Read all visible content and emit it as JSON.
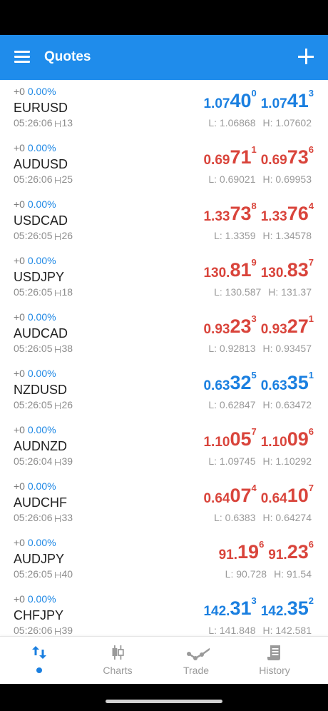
{
  "app": {
    "title": "Quotes"
  },
  "quotes": [
    {
      "change": "+0",
      "percent": "0.00%",
      "symbol": "EURUSD",
      "time": "05:26:06",
      "spread": "13",
      "color": "blue",
      "bid": {
        "base": "1.07",
        "big": "40",
        "sup": "0"
      },
      "ask": {
        "base": "1.07",
        "big": "41",
        "sup": "3"
      },
      "low": "L: 1.06868",
      "high": "H: 1.07602"
    },
    {
      "change": "+0",
      "percent": "0.00%",
      "symbol": "AUDUSD",
      "time": "05:26:06",
      "spread": "25",
      "color": "red",
      "bid": {
        "base": "0.69",
        "big": "71",
        "sup": "1"
      },
      "ask": {
        "base": "0.69",
        "big": "73",
        "sup": "6"
      },
      "low": "L: 0.69021",
      "high": "H: 0.69953"
    },
    {
      "change": "+0",
      "percent": "0.00%",
      "symbol": "USDCAD",
      "time": "05:26:05",
      "spread": "26",
      "color": "red",
      "bid": {
        "base": "1.33",
        "big": "73",
        "sup": "8"
      },
      "ask": {
        "base": "1.33",
        "big": "76",
        "sup": "4"
      },
      "low": "L: 1.3359",
      "high": "H: 1.34578"
    },
    {
      "change": "+0",
      "percent": "0.00%",
      "symbol": "USDJPY",
      "time": "05:26:05",
      "spread": "18",
      "color": "red",
      "bid": {
        "base": "130.",
        "big": "81",
        "sup": "9"
      },
      "ask": {
        "base": "130.",
        "big": "83",
        "sup": "7"
      },
      "low": "L: 130.587",
      "high": "H: 131.37"
    },
    {
      "change": "+0",
      "percent": "0.00%",
      "symbol": "AUDCAD",
      "time": "05:26:05",
      "spread": "38",
      "color": "red",
      "bid": {
        "base": "0.93",
        "big": "23",
        "sup": "3"
      },
      "ask": {
        "base": "0.93",
        "big": "27",
        "sup": "1"
      },
      "low": "L: 0.92813",
      "high": "H: 0.93457"
    },
    {
      "change": "+0",
      "percent": "0.00%",
      "symbol": "NZDUSD",
      "time": "05:26:05",
      "spread": "26",
      "color": "blue",
      "bid": {
        "base": "0.63",
        "big": "32",
        "sup": "5"
      },
      "ask": {
        "base": "0.63",
        "big": "35",
        "sup": "1"
      },
      "low": "L: 0.62847",
      "high": "H: 0.63472"
    },
    {
      "change": "+0",
      "percent": "0.00%",
      "symbol": "AUDNZD",
      "time": "05:26:04",
      "spread": "39",
      "color": "red",
      "bid": {
        "base": "1.10",
        "big": "05",
        "sup": "7"
      },
      "ask": {
        "base": "1.10",
        "big": "09",
        "sup": "6"
      },
      "low": "L: 1.09745",
      "high": "H: 1.10292"
    },
    {
      "change": "+0",
      "percent": "0.00%",
      "symbol": "AUDCHF",
      "time": "05:26:06",
      "spread": "33",
      "color": "red",
      "bid": {
        "base": "0.64",
        "big": "07",
        "sup": "4"
      },
      "ask": {
        "base": "0.64",
        "big": "10",
        "sup": "7"
      },
      "low": "L: 0.6383",
      "high": "H: 0.64274"
    },
    {
      "change": "+0",
      "percent": "0.00%",
      "symbol": "AUDJPY",
      "time": "05:26:05",
      "spread": "40",
      "color": "red",
      "bid": {
        "base": "91.",
        "big": "19",
        "sup": "6"
      },
      "ask": {
        "base": "91.",
        "big": "23",
        "sup": "6"
      },
      "low": "L: 90.728",
      "high": "H: 91.54"
    },
    {
      "change": "+0",
      "percent": "0.00%",
      "symbol": "CHFJPY",
      "time": "05:26:06",
      "spread": "39",
      "color": "blue",
      "bid": {
        "base": "142.",
        "big": "31",
        "sup": "3"
      },
      "ask": {
        "base": "142.",
        "big": "35",
        "sup": "2"
      },
      "low": "L: 141.848",
      "high": "H: 142.581"
    }
  ],
  "nav": [
    {
      "label": "",
      "icon": "quotes-arrows-icon",
      "active": true
    },
    {
      "label": "Charts",
      "icon": "candlestick-icon",
      "active": false
    },
    {
      "label": "Trade",
      "icon": "trade-line-icon",
      "active": false
    },
    {
      "label": "History",
      "icon": "history-scroll-icon",
      "active": false
    }
  ],
  "colors": {
    "accent": "#1f8ceb",
    "up": "#1a7fe0",
    "down": "#d9443b"
  }
}
